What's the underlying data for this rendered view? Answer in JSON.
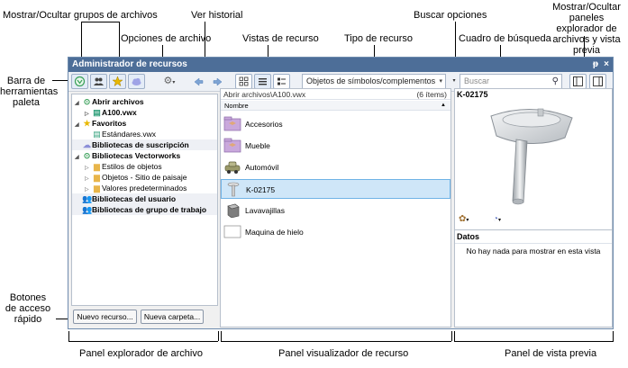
{
  "callouts": {
    "show_hide_groups": "Mostrar/Ocultar grupos de archivos",
    "view_history": "Ver historial",
    "search_options": "Buscar opciones",
    "show_hide_panels": "Mostrar/Ocultar paneles explorador de archivos y vista previa",
    "file_options": "Opciones de archivo",
    "resource_views": "Vistas de recurso",
    "resource_type": "Tipo de recurso",
    "search_box": "Cuadro de búsqueda",
    "palette_toolbar": "Barra de herramientas paleta",
    "quick_access_buttons": "Botones de acceso rápido",
    "file_browser_panel": "Panel explorador de archivo",
    "resource_viewer_panel": "Panel visualizador de recurso",
    "preview_panel": "Panel de vista previa"
  },
  "window": {
    "title": "Administrador de recursos",
    "pin_glyph": "ᵽ",
    "close_glyph": "×"
  },
  "toolbar": {
    "resource_type_value": "Objetos de símbolos/complementos",
    "search_placeholder": "Buscar"
  },
  "file_browser": {
    "rows": [
      {
        "label": "Abrir archivos"
      },
      {
        "label": "A100.vwx"
      },
      {
        "label": "Favoritos"
      },
      {
        "label": "Estándares.vwx"
      },
      {
        "label": "Bibliotecas de suscripción"
      },
      {
        "label": "Bibliotecas Vectorworks"
      },
      {
        "label": "Estilos de objetos"
      },
      {
        "label": "Objetos - Sitio de paisaje"
      },
      {
        "label": "Valores predeterminados"
      },
      {
        "label": "Bibliotecas del usuario"
      },
      {
        "label": "Bibliotecas de grupo de trabajo"
      }
    ],
    "new_resource_button": "Nuevo recurso...",
    "new_folder_button": "Nueva carpeta..."
  },
  "resource_viewer": {
    "path": "Abrir archivos\\A100.vwx",
    "count": "(6 ítems)",
    "column_header": "Nombre",
    "items": [
      {
        "label": "Accesorios"
      },
      {
        "label": "Mueble"
      },
      {
        "label": "Automóvil"
      },
      {
        "label": "K-02175"
      },
      {
        "label": "Lavavajillas"
      },
      {
        "label": "Maquina de hielo"
      }
    ]
  },
  "preview": {
    "title": "K-02175",
    "data_header": "Datos",
    "data_empty": "No hay nada para mostrar en esta vista"
  },
  "colors": {
    "titlebar": "#4d6e98",
    "selection": "#cfe6f8",
    "folder": "#c9a8dc",
    "favorite_star": "#e8b800",
    "library_icon": "#8c8fd8"
  }
}
